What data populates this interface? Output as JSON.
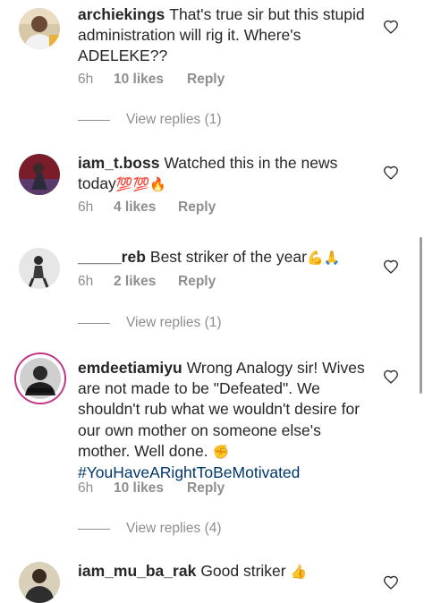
{
  "comments": [
    {
      "username": "archiekings",
      "text": "That's true sir but this stupid administration will rig it. Where's ADELEKE??",
      "time": "6h",
      "likes": "10 likes",
      "reply": "Reply",
      "view_replies": "View replies (1)"
    },
    {
      "username": "iam_t.boss",
      "text": "Watched this in the news today",
      "emoji": "💯💯🔥",
      "time": "6h",
      "likes": "4 likes",
      "reply": "Reply"
    },
    {
      "username": "_____reb",
      "text": "Best striker of the year",
      "emoji": "💪🙏",
      "time": "6h",
      "likes": "2 likes",
      "reply": "Reply",
      "view_replies": "View replies (1)"
    },
    {
      "username": "emdeetiamiyu",
      "text": "Wrong Analogy sir! Wives are not made to be \"Defeated\". We shouldn't rub what we wouldn't desire for our own mother on someone else's mother. Well done.",
      "emoji": "✊",
      "hashtag": "#YouHaveARightToBeMotivated",
      "time": "6h",
      "likes": "10 likes",
      "reply": "Reply",
      "view_replies": "View replies (4)"
    },
    {
      "username": "iam_mu_ba_rak",
      "text": "Good striker",
      "emoji": "👍"
    }
  ],
  "icons": {
    "like": "heart-outline-icon"
  },
  "colors": {
    "text": "#262626",
    "secondary": "#8e8e8e",
    "hashtag": "#00376b",
    "story_ring": "#c13584"
  }
}
